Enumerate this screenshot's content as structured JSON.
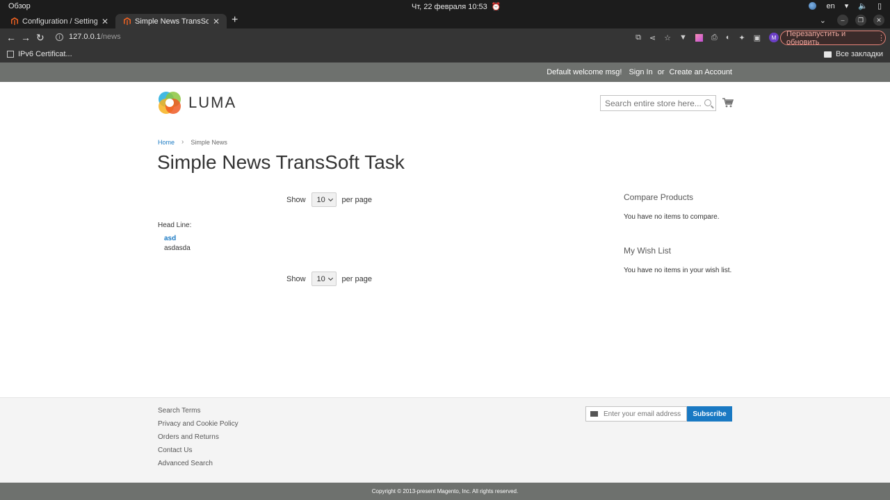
{
  "os": {
    "activities": "Обзор",
    "datetime": "Чт, 22 февраля  10:53",
    "lang": "en"
  },
  "browser": {
    "tabs": [
      {
        "title": "Configuration / Settings / "
      },
      {
        "title": "Simple News TransSoft Ta"
      }
    ],
    "url_host": "127.0.0.1",
    "url_path": "/news",
    "relaunch_label": "Перезапустить и обновить",
    "profile_initial": "M",
    "bookmark": "IPv6 Certificat...",
    "all_bookmarks": "Все закладки"
  },
  "header": {
    "welcome": "Default welcome msg!",
    "sign_in": "Sign In",
    "or": "or",
    "create_account": "Create an Account",
    "logo_text": "LUMA",
    "search_placeholder": "Search entire store here..."
  },
  "breadcrumb": {
    "home": "Home",
    "current": "Simple News"
  },
  "page": {
    "title": "Simple News TransSoft Task",
    "show_label": "Show",
    "limit_value": "10",
    "per_page_label": "per page",
    "headline_label": "Head Line:",
    "news": [
      {
        "title": "asd",
        "body": "asdasda"
      }
    ]
  },
  "sidebar": {
    "compare_title": "Compare Products",
    "compare_text": "You have no items to compare.",
    "wishlist_title": "My Wish List",
    "wishlist_text": "You have no items in your wish list."
  },
  "footer": {
    "links": [
      "Search Terms",
      "Privacy and Cookie Policy",
      "Orders and Returns",
      "Contact Us",
      "Advanced Search"
    ],
    "newsletter_placeholder": "Enter your email address",
    "subscribe_label": "Subscribe",
    "copyright": "Copyright © 2013-present Magento, Inc. All rights reserved."
  },
  "colors": {
    "accent": "#1979c3",
    "panel": "#6e716e"
  }
}
